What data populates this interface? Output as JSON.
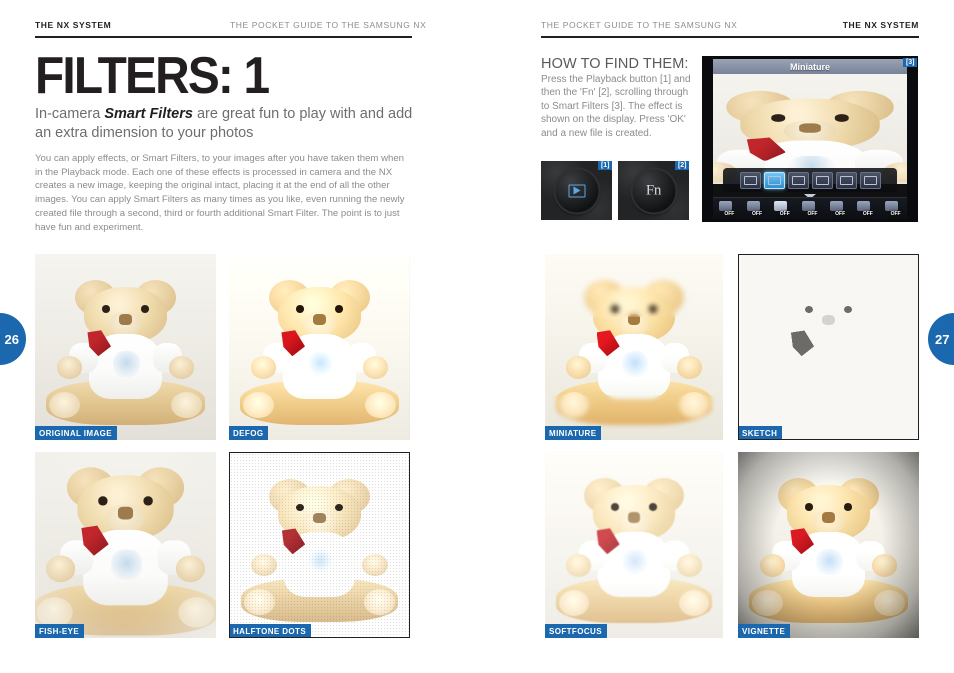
{
  "left_page": {
    "running_head_bold": "THE NX SYSTEM",
    "running_head_light": "THE POCKET GUIDE TO THE SAMSUNG NX",
    "page_number": "26",
    "headline": "FILTERS: 1",
    "standfirst_pre": "In-camera ",
    "standfirst_em": "Smart Filters",
    "standfirst_post": " are great fun to play with and add an extra dimension to your photos",
    "body": "You can apply effects, or Smart Filters, to your images after you have taken them when in the Playback mode. Each one of these effects is processed in camera and the NX creates a new image, keeping the original intact, placing it at the end of all the other images. You can apply Smart Filters as many times as you like, even running the newly created file through a second, third or fourth additional Smart Filter. The point is to just have fun and experiment."
  },
  "right_page": {
    "running_head_light": "THE POCKET GUIDE TO THE SAMSUNG NX",
    "running_head_bold": "THE NX SYSTEM",
    "page_number": "27",
    "howto_title": "HOW TO FIND THEM:",
    "howto_body": "Press the Playback button [1] and then the 'Fn' [2], scrolling through to Smart Filters [3]. The effect is shown on the display. Press 'OK' and a new file is created."
  },
  "callouts": {
    "playback_button": {
      "badge": "[1]",
      "icon": "playback-triangle-icon"
    },
    "fn_button": {
      "badge": "[2]",
      "label": "Fn",
      "icon": "fn-button-icon"
    },
    "lcd": {
      "badge": "[3]",
      "title": "Miniature",
      "filter_icons": [
        "smart-filter-off-icon",
        "miniature-filter-icon",
        "vignette-filter-icon",
        "soft-focus-filter-icon",
        "halftone-filter-icon",
        "sketch-filter-icon"
      ],
      "selected_filter_index": 1,
      "status_icons": [
        {
          "icon": "smart-filter-icon",
          "label": "OFF",
          "active": false
        },
        {
          "icon": "picture-wizard-icon",
          "label": "OFF",
          "active": false
        },
        {
          "icon": "smart-range-icon",
          "label": "OFF",
          "active": true
        },
        {
          "icon": "drive-mode-icon",
          "label": "OFF",
          "active": false
        },
        {
          "icon": "exposure-comp-icon",
          "label": "OFF",
          "active": false
        },
        {
          "icon": "metering-icon",
          "label": "OFF",
          "active": false
        },
        {
          "icon": "flash-icon",
          "label": "OFF",
          "active": false
        }
      ]
    }
  },
  "gallery": {
    "left": [
      {
        "caption": "ORIGINAL IMAGE",
        "effect": "original",
        "bordered": false
      },
      {
        "caption": "DEFOG",
        "effect": "defog",
        "bordered": false
      },
      {
        "caption": "FISH-EYE",
        "effect": "fisheye",
        "bordered": false
      },
      {
        "caption": "HALFTONE DOTS",
        "effect": "halftone",
        "bordered": true
      }
    ],
    "right": [
      {
        "caption": "MINIATURE",
        "effect": "miniature",
        "bordered": false
      },
      {
        "caption": "SKETCH",
        "effect": "sketch",
        "bordered": true
      },
      {
        "caption": "SOFTFOCUS",
        "effect": "softfocus",
        "bordered": false
      },
      {
        "caption": "VIGNETTE",
        "effect": "vignette",
        "bordered": false
      }
    ]
  },
  "colors": {
    "accent_blue": "#1b68ae",
    "ink": "#231f20",
    "body_grey": "#8a8c8e",
    "standfirst_grey": "#6d6e71"
  }
}
